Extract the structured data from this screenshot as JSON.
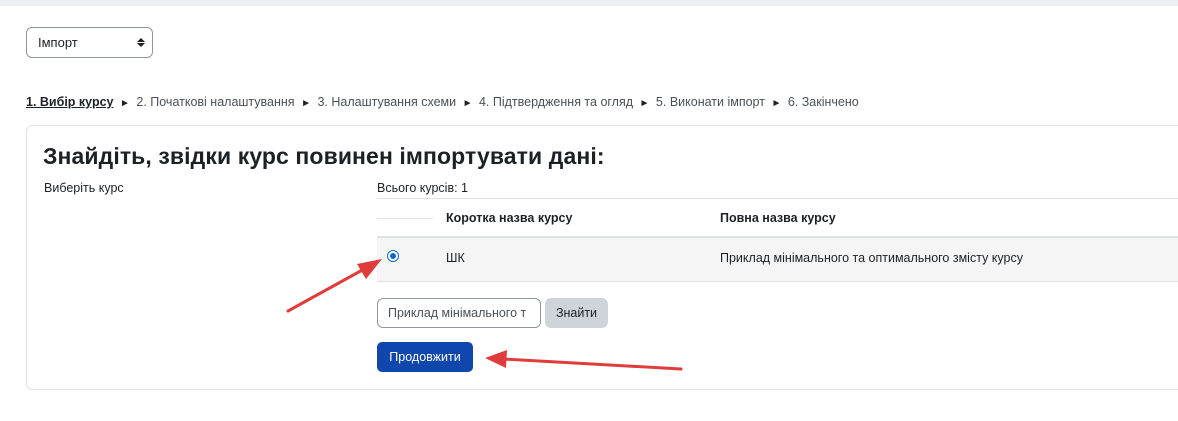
{
  "import_select": {
    "value": "Імпорт"
  },
  "steps": [
    {
      "label": "1. Вибір курсу",
      "current": true
    },
    {
      "label": "2. Початкові налаштування"
    },
    {
      "label": "3. Налаштування схеми"
    },
    {
      "label": "4. Підтвердження та огляд"
    },
    {
      "label": "5. Виконати імпорт"
    },
    {
      "label": "6. Закінчено"
    }
  ],
  "step_separator": "►",
  "section": {
    "heading": "Знайдіть, звідки курс повинен імпортувати дані:",
    "select_label": "Виберіть курс",
    "total": "Всього курсів: 1"
  },
  "table": {
    "headers": [
      "Коротка назва курсу",
      "Повна назва курсу"
    ],
    "rows": [
      {
        "short": "ШК",
        "full": "Приклад мінімального та оптимального змісту курсу",
        "selected": true
      }
    ]
  },
  "search": {
    "value": "Приклад мінімального т",
    "button": "Знайти"
  },
  "continue_button": "Продовжити",
  "colors": {
    "primary": "#0f47ad",
    "annotation_arrow": "#e03c3c"
  }
}
